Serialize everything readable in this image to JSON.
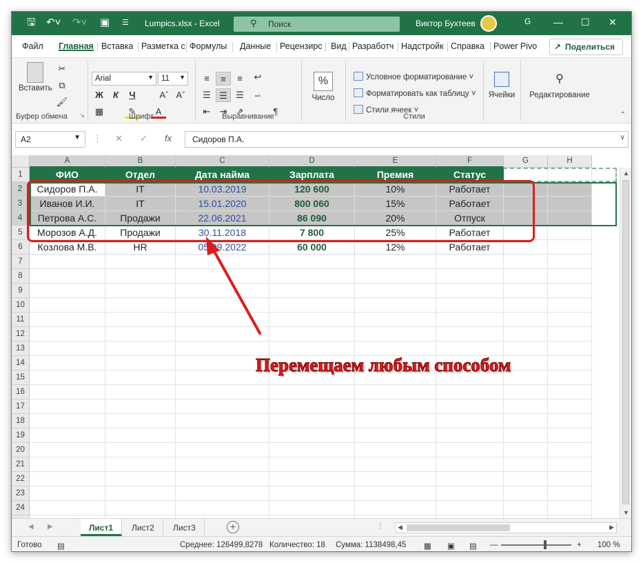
{
  "window": {
    "title": "Lumpics.xlsx - Excel",
    "search_placeholder": "Поиск",
    "user": "Виктор Бухтеев"
  },
  "ribbon_tabs": [
    "Файл",
    "Главная",
    "Вставка",
    "Разметка с",
    "Формулы",
    "Данные",
    "Рецензирс",
    "Вид",
    "Разработч",
    "Надстройк",
    "Справка",
    "Power Pivo"
  ],
  "share_label": "Поделиться",
  "ribbon": {
    "clipboard": {
      "paste": "Вставить",
      "label": "Буфер обмена"
    },
    "font": {
      "name": "Arial",
      "size": "11",
      "label": "Шрифт",
      "bold": "Ж",
      "italic": "К",
      "underline": "Ч"
    },
    "align": {
      "label": "Выравнивание"
    },
    "number": {
      "btn": "Число",
      "label": ""
    },
    "styles": {
      "cond": "Условное форматирование",
      "table": "Форматировать как таблицу",
      "cell": "Стили ячеек",
      "label": "Стили"
    },
    "cells": {
      "btn": "Ячейки"
    },
    "editing": {
      "btn": "Редактирование"
    }
  },
  "formula_bar": {
    "name_box": "A2",
    "content": "Сидоров П.А."
  },
  "columns": [
    "A",
    "B",
    "C",
    "D",
    "E",
    "F",
    "G",
    "H"
  ],
  "header_row": [
    "ФИО",
    "Отдел",
    "Дата найма",
    "Зарплата",
    "Премия",
    "Статус"
  ],
  "rows": [
    [
      "Сидоров П.А.",
      "IT",
      "10.03.2019",
      "120 600",
      "10%",
      "Работает"
    ],
    [
      "Иванов И.И.",
      "IT",
      "15.01.2020",
      "800 060",
      "15%",
      "Работает"
    ],
    [
      "Петрова А.С.",
      "Продажи",
      "22.06.2021",
      "86 090",
      "20%",
      "Отпуск"
    ],
    [
      "Морозов А.Д.",
      "Продажи",
      "30.11.2018",
      "7 800",
      "25%",
      "Работает"
    ],
    [
      "Козлова М.В.",
      "HR",
      "05.09.2022",
      "60 000",
      "12%",
      "Работает"
    ]
  ],
  "caption": "Перемещаем любым способом",
  "sheets": [
    "Лист1",
    "Лист2",
    "Лист3"
  ],
  "status": {
    "ready": "Готово",
    "average": "Среднее: 126499,8278",
    "count": "Количество: 18",
    "sum": "Сумма: 1138498,45",
    "zoom": "100 %"
  },
  "colors": {
    "accent": "#217346",
    "annotation": "#e01b1b"
  }
}
